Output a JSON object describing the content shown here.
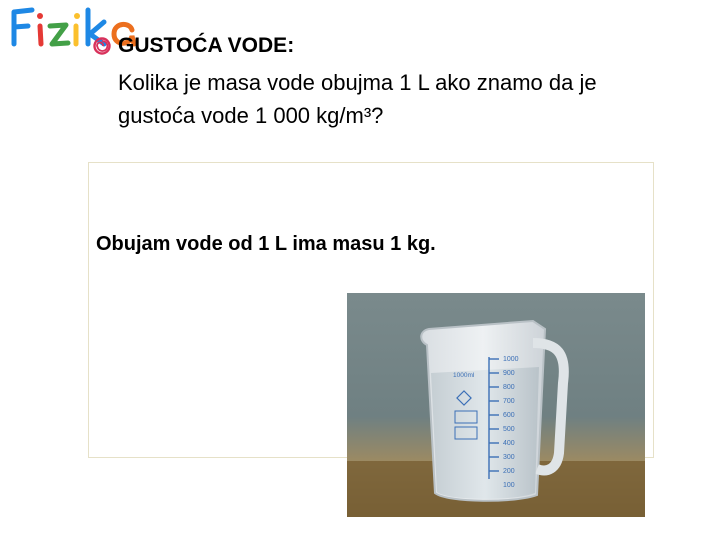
{
  "logo": {
    "text": "Fizika",
    "colors": [
      "#1e88e5",
      "#e53935",
      "#43a047",
      "#fbc02d",
      "#ec6f1e"
    ]
  },
  "slide": {
    "title": "GUSTOĆA VODE:",
    "question": "Kolika je masa vode obujma 1 L ako znamo da je gustoća vode 1 000 kg/m³?",
    "answer": "Obujam vode od 1 L ima masu 1 kg."
  },
  "photo": {
    "subject": "measuring beaker with water",
    "beaker_label": "1000ml",
    "scale": [
      "1000",
      "900",
      "800",
      "700",
      "600",
      "500",
      "400",
      "300",
      "200",
      "100"
    ]
  }
}
